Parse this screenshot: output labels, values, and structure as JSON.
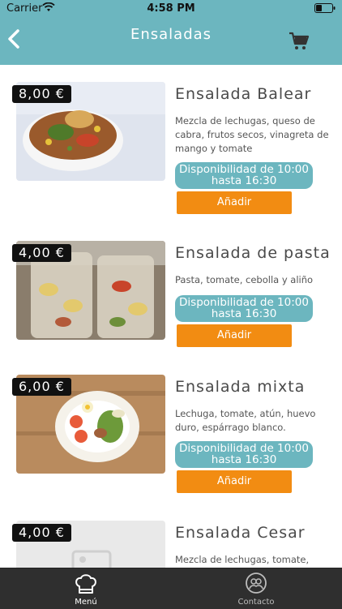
{
  "status_bar": {
    "carrier": "Carrier",
    "time": "4:58 PM"
  },
  "header": {
    "title": "Ensaladas"
  },
  "items": [
    {
      "price": "8,00 €",
      "name": "Ensalada Balear",
      "description": "Mezcla de lechugas, queso de cabra, frutos secos, vinagreta de mango y tomate",
      "availability": "Disponibilidad de 10:00 hasta 16:30",
      "add_label": "Añadir"
    },
    {
      "price": "4,00 €",
      "name": "Ensalada de pasta",
      "description": "Pasta, tomate, cebolla y aliño",
      "availability": "Disponibilidad de 10:00 hasta 16:30",
      "add_label": "Añadir"
    },
    {
      "price": "6,00 €",
      "name": "Ensalada mixta",
      "description": "Lechuga, tomate, atún, huevo duro, espárrago blanco.",
      "availability": "Disponibilidad de 10:00 hasta 16:30",
      "add_label": "Añadir"
    },
    {
      "price": "4,00 €",
      "name": "Ensalada Cesar",
      "description": "Mezcla de lechugas, tomate,"
    }
  ],
  "tabbar": {
    "menu_label": "Menú",
    "contact_label": "Contacto"
  },
  "colors": {
    "header_bg": "#6cb6bf",
    "add_button": "#f28c12",
    "tabbar_bg": "#2f2f2f"
  }
}
